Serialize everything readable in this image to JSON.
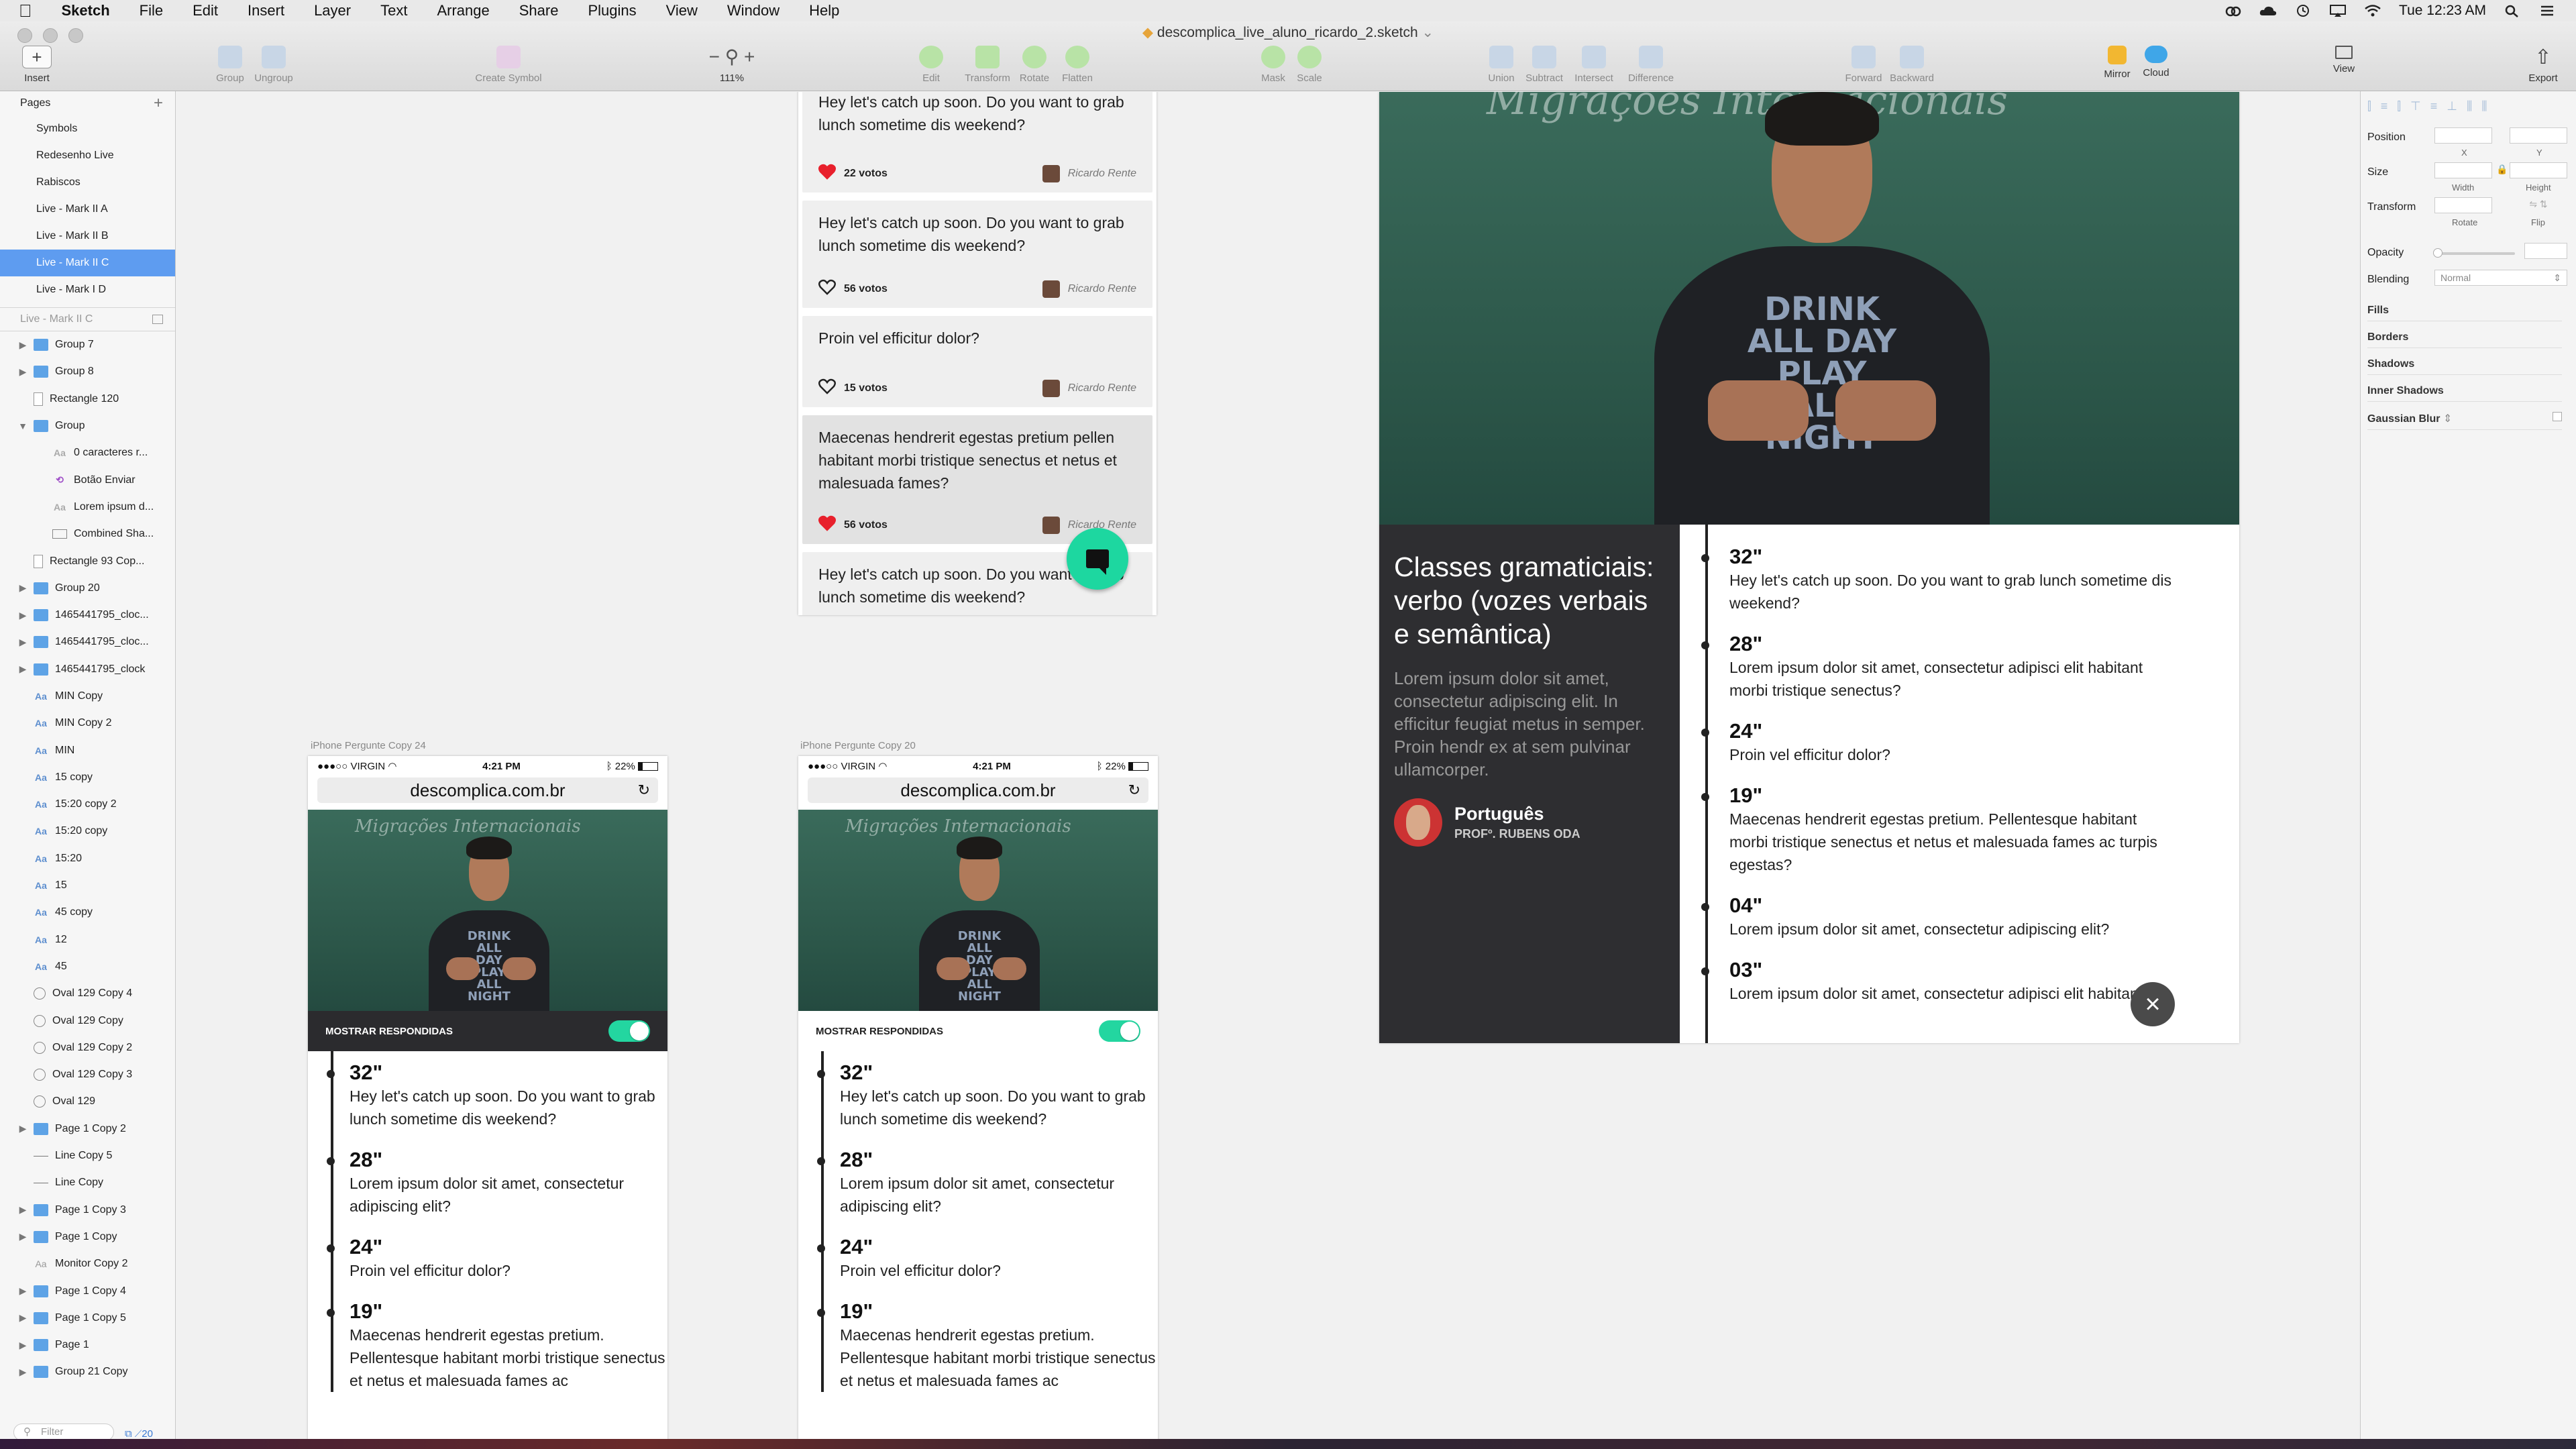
{
  "menubar": {
    "app": "Sketch",
    "items": [
      "File",
      "Edit",
      "Insert",
      "Layer",
      "Text",
      "Arrange",
      "Share",
      "Plugins",
      "View",
      "Window",
      "Help"
    ],
    "clock": "Tue 12:23 AM"
  },
  "window": {
    "title": "descomplica_live_aluno_ricardo_2.sketch"
  },
  "toolbar": {
    "insert": "Insert",
    "group": "Group",
    "ungroup": "Ungroup",
    "create_symbol": "Create Symbol",
    "zoom": "111%",
    "edit": "Edit",
    "transform": "Transform",
    "rotate": "Rotate",
    "flatten": "Flatten",
    "mask": "Mask",
    "scale": "Scale",
    "union": "Union",
    "subtract": "Subtract",
    "intersect": "Intersect",
    "difference": "Difference",
    "forward": "Forward",
    "backward": "Backward",
    "mirror": "Mirror",
    "cloud": "Cloud",
    "view": "View",
    "export": "Export"
  },
  "pages_panel": {
    "header": "Pages",
    "pages": [
      "Symbols",
      "Redesenho Live",
      "Rabiscos",
      "Live - Mark II A",
      "Live - Mark II B",
      "Live - Mark II C",
      "Live - Mark I D"
    ],
    "selected_index": 5,
    "current_page": "Live - Mark II C",
    "layers": [
      {
        "name": "Group 7",
        "type": "folder",
        "indent": 0,
        "arrow": "▶"
      },
      {
        "name": "Group 8",
        "type": "folder",
        "indent": 0,
        "arrow": "▶"
      },
      {
        "name": "Rectangle 120",
        "type": "rect",
        "indent": 0,
        "arrow": ""
      },
      {
        "name": "Group",
        "type": "folder",
        "indent": 0,
        "arrow": "▼"
      },
      {
        "name": "0 caracteres r...",
        "type": "text",
        "indent": 1,
        "arrow": ""
      },
      {
        "name": "Botão Enviar",
        "type": "symbol",
        "indent": 1,
        "arrow": ""
      },
      {
        "name": "Lorem ipsum d...",
        "type": "text",
        "indent": 1,
        "arrow": ""
      },
      {
        "name": "Combined Sha...",
        "type": "shape",
        "indent": 1,
        "arrow": ""
      },
      {
        "name": "Rectangle 93 Cop...",
        "type": "rect",
        "indent": 0,
        "arrow": ""
      },
      {
        "name": "Group 20",
        "type": "folder",
        "indent": 0,
        "arrow": "▶"
      },
      {
        "name": "1465441795_cloc...",
        "type": "folder",
        "indent": 0,
        "arrow": "▶"
      },
      {
        "name": "1465441795_cloc...",
        "type": "folder",
        "indent": 0,
        "arrow": "▶"
      },
      {
        "name": "1465441795_clock",
        "type": "folder",
        "indent": 0,
        "arrow": "▶"
      },
      {
        "name": "MIN Copy",
        "type": "text",
        "indent": 0,
        "arrow": ""
      },
      {
        "name": "MIN Copy 2",
        "type": "text",
        "indent": 0,
        "arrow": ""
      },
      {
        "name": "MIN",
        "type": "text",
        "indent": 0,
        "arrow": ""
      },
      {
        "name": "15 copy",
        "type": "text",
        "indent": 0,
        "arrow": ""
      },
      {
        "name": "15:20 copy 2",
        "type": "text",
        "indent": 0,
        "arrow": ""
      },
      {
        "name": "15:20 copy",
        "type": "text",
        "indent": 0,
        "arrow": ""
      },
      {
        "name": "15:20",
        "type": "text",
        "indent": 0,
        "arrow": ""
      },
      {
        "name": "15",
        "type": "text",
        "indent": 0,
        "arrow": ""
      },
      {
        "name": "45 copy",
        "type": "text",
        "indent": 0,
        "arrow": ""
      },
      {
        "name": "12",
        "type": "text",
        "indent": 0,
        "arrow": ""
      },
      {
        "name": "45",
        "type": "text",
        "indent": 0,
        "arrow": ""
      },
      {
        "name": "Oval 129 Copy 4",
        "type": "oval",
        "indent": 0,
        "arrow": ""
      },
      {
        "name": "Oval 129 Copy",
        "type": "oval",
        "indent": 0,
        "arrow": ""
      },
      {
        "name": "Oval 129 Copy 2",
        "type": "oval",
        "indent": 0,
        "arrow": ""
      },
      {
        "name": "Oval 129 Copy 3",
        "type": "oval",
        "indent": 0,
        "arrow": ""
      },
      {
        "name": "Oval 129",
        "type": "oval",
        "indent": 0,
        "arrow": ""
      },
      {
        "name": "Page 1 Copy 2",
        "type": "folder",
        "indent": 0,
        "arrow": "▶"
      },
      {
        "name": "Line Copy 5",
        "type": "line",
        "indent": 0,
        "arrow": ""
      },
      {
        "name": "Line Copy",
        "type": "line",
        "indent": 0,
        "arrow": ""
      },
      {
        "name": "Page 1 Copy 3",
        "type": "folder",
        "indent": 0,
        "arrow": "▶"
      },
      {
        "name": "Page 1 Copy",
        "type": "folder",
        "indent": 0,
        "arrow": "▶"
      },
      {
        "name": "Monitor Copy 2",
        "type": "textgray",
        "indent": 0,
        "arrow": ""
      },
      {
        "name": "Page 1 Copy 4",
        "type": "folder",
        "indent": 0,
        "arrow": "▶"
      },
      {
        "name": "Page 1 Copy 5",
        "type": "folder",
        "indent": 0,
        "arrow": "▶"
      },
      {
        "name": "Page 1",
        "type": "folder",
        "indent": 0,
        "arrow": "▶"
      },
      {
        "name": "Group 21 Copy",
        "type": "folder",
        "indent": 0,
        "arrow": "▶"
      }
    ],
    "filter_placeholder": "Filter",
    "count": "20"
  },
  "inspector": {
    "position": "Position",
    "x": "X",
    "y": "Y",
    "size": "Size",
    "width": "Width",
    "height": "Height",
    "transform": "Transform",
    "rotate": "Rotate",
    "flip": "Flip",
    "opacity": "Opacity",
    "blending": "Blending",
    "blending_value": "Normal",
    "fills": "Fills",
    "borders": "Borders",
    "shadows": "Shadows",
    "inner_shadows": "Inner Shadows",
    "gaussian_blur": "Gaussian Blur"
  },
  "question_cards": [
    {
      "text": "Hey let's catch up soon. Do you want to grab lunch sometime dis weekend?",
      "votes": "22 votos",
      "author": "Ricardo Rente",
      "liked": true
    },
    {
      "text": "Hey let's catch up soon. Do you want to grab lunch sometime dis weekend?",
      "votes": "56 votos",
      "author": "Ricardo Rente",
      "liked": false
    },
    {
      "text": "Proin vel efficitur dolor?",
      "votes": "15 votos",
      "author": "Ricardo Rente",
      "liked": false
    },
    {
      "text": "Maecenas hendrerit egestas pretium pellen habitant morbi tristique senectus et netus et malesuada fames?",
      "votes": "56 votos",
      "author": "Ricardo Rente",
      "liked": true
    },
    {
      "text": "Hey let's catch up soon. Do you want to grab lunch sometime dis weekend?",
      "votes": "",
      "author": "",
      "liked": false
    }
  ],
  "phones": [
    {
      "label": "iPhone Pergunte Copy 24",
      "carrier": "●●●○○ VIRGIN",
      "time": "4:21 PM",
      "battery": "22%",
      "url": "descomplica.com.br",
      "toggle_label": "MOSTRAR RESPONDIDAS",
      "dark": true
    },
    {
      "label": "iPhone Pergunte Copy 20",
      "carrier": "●●●○○ VIRGIN",
      "time": "4:21 PM",
      "battery": "22%",
      "url": "descomplica.com.br",
      "toggle_label": "MOSTRAR RESPONDIDAS",
      "dark": false
    }
  ],
  "video": {
    "board_text": "Migrações Internacionais",
    "shirt": [
      "DRINK",
      "ALL DAY",
      "PLAY ALL",
      "NIGHT"
    ]
  },
  "timeline": [
    {
      "time": "32\"",
      "text": "Hey let's catch up soon. Do you want to grab lunch sometime dis weekend?"
    },
    {
      "time": "28\"",
      "text": "Lorem ipsum dolor sit amet, consectetur adipisci elit habitant morbi tristique senectus?"
    },
    {
      "time": "24\"",
      "text": "Proin vel efficitur dolor?"
    },
    {
      "time": "19\"",
      "text": "Maecenas hendrerit egestas pretium. Pellentesque habitant morbi tristique senectus et netus et malesuada fames ac turpis egestas?"
    },
    {
      "time": "04\"",
      "text": "Lorem ipsum dolor sit amet, consectetur adipiscing elit?"
    },
    {
      "time": "03\"",
      "text": "Lorem ipsum dolor sit amet, consectetur adipisci elit habitant"
    }
  ],
  "phone_timeline": [
    {
      "time": "32\"",
      "text": "Hey let's catch up soon. Do you want to grab lunch sometime dis weekend?"
    },
    {
      "time": "28\"",
      "text": "Lorem ipsum dolor sit amet, consectetur adipiscing elit?"
    },
    {
      "time": "24\"",
      "text": "Proin vel efficitur dolor?"
    },
    {
      "time": "19\"",
      "text": "Maecenas hendrerit egestas pretium. Pellentesque habitant morbi tristique senectus et netus et malesuada fames ac"
    }
  ],
  "lesson": {
    "title": "Classes gramaticiais: verbo (vozes verbais e semântica)",
    "description": "Lorem ipsum dolor sit amet, consectetur adipiscing elit. In efficitur feugiat metus in semper. Proin hendr ex at sem pulvinar ullamcorper.",
    "subject": "Português",
    "professor": "PROFº. RUBENS ODA"
  },
  "colors": {
    "accent": "#23d6a0",
    "selection": "#5e9cf0",
    "dark_panel": "#2e2e31",
    "heart": "#e8202c"
  }
}
